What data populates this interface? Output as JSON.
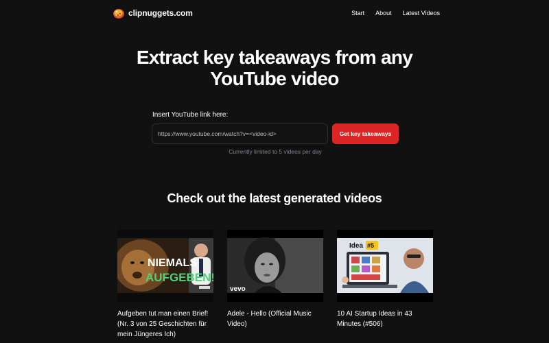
{
  "site": {
    "name": "clipnuggets.com"
  },
  "nav": {
    "items": [
      "Start",
      "About",
      "Latest Videos"
    ]
  },
  "hero": {
    "title_line1": "Extract key takeaways from any",
    "title_line2": "YouTube video"
  },
  "form": {
    "label": "Insert YouTube link here:",
    "placeholder": "https://www.youtube.com/watch?v=<video-id>",
    "value": "",
    "button_label": "Get key takeaways",
    "limit_note": "Currently limited to 5 videos per day"
  },
  "latest": {
    "heading": "Check out the latest generated videos",
    "videos": [
      {
        "title": "Aufgeben tut man einen Brief! (Nr. 3 von 25 Geschichten für mein Jüngeres Ich)",
        "thumb_line1": "NIEMALS",
        "thumb_line2": "AUFGEBEN!!"
      },
      {
        "title": "Adele - Hello (Official Music Video)",
        "thumb_logo": "vevo"
      },
      {
        "title": "10 AI Startup Ideas in 43 Minutes (#506)",
        "thumb_label": "Idea",
        "thumb_number": "#5"
      }
    ]
  },
  "colors": {
    "background": "#111111",
    "accent": "#dc2626",
    "muted": "#7d8590"
  }
}
